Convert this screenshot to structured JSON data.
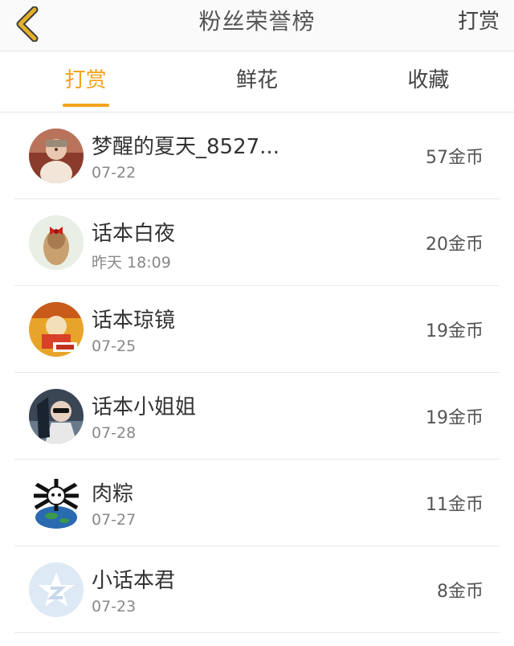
{
  "header": {
    "title": "粉丝荣誉榜",
    "right_action": "打赏",
    "back_color": "#e4b02a"
  },
  "tabs": [
    {
      "label": "打赏",
      "active": true
    },
    {
      "label": "鲜花",
      "active": false
    },
    {
      "label": "收藏",
      "active": false
    }
  ],
  "accent_color": "#f3a31a",
  "items": [
    {
      "name": "梦醒的夏天_8527...",
      "date": "07-22",
      "amount": "57金币",
      "avatar": "baby-photo"
    },
    {
      "name": "话本白夜",
      "date": "昨天 18:09",
      "amount": "20金币",
      "avatar": "girl-with-bow"
    },
    {
      "name": "话本琼镜",
      "date": "07-25",
      "amount": "19金币",
      "avatar": "cartoon-character"
    },
    {
      "name": "话本小姐姐",
      "date": "07-28",
      "amount": "19金币",
      "avatar": "person-sunglasses"
    },
    {
      "name": "肉粽",
      "date": "07-27",
      "amount": "11金币",
      "avatar": "skull-bones-globe"
    },
    {
      "name": "小话本君",
      "date": "07-23",
      "amount": "8金币",
      "avatar": "default-star"
    }
  ]
}
